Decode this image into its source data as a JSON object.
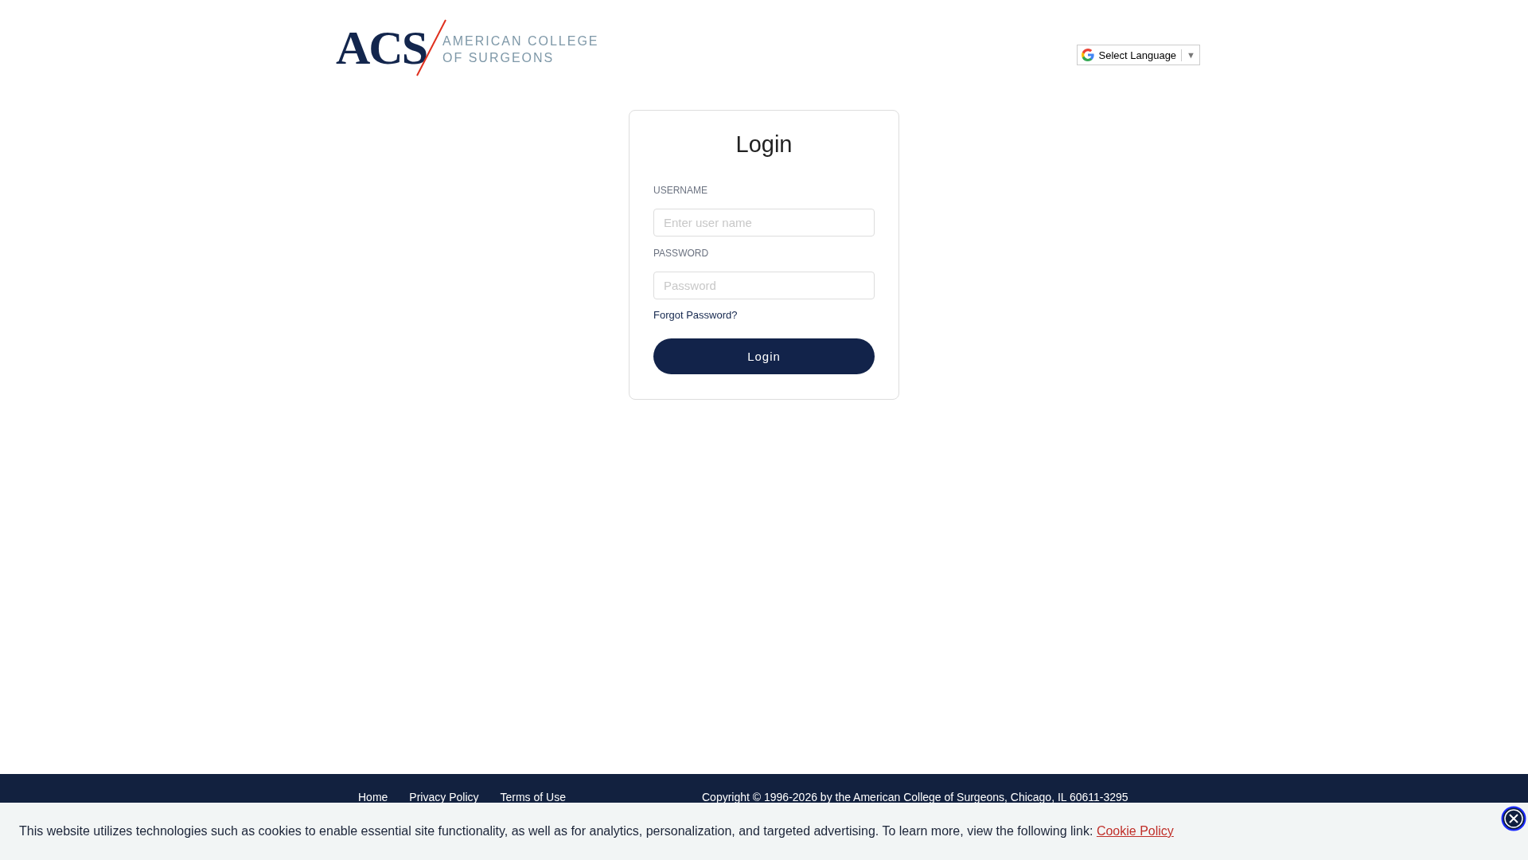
{
  "header": {
    "logo_mark": "ACS",
    "logo_text": [
      "AMERICAN COLLEGE",
      "OF SURGEONS"
    ],
    "language_select": {
      "label": "Select Language",
      "caret": "▼"
    }
  },
  "login": {
    "title": "Login",
    "fields": [
      {
        "label": "USERNAME",
        "placeholder": "Enter user name"
      },
      {
        "label": "PASSWORD",
        "placeholder": "Password"
      }
    ],
    "forgot_link": "Forgot Password?",
    "submit": "Login"
  },
  "footer": {
    "links": [
      "Home",
      "Privacy Policy",
      "Terms of Use"
    ],
    "copyright": "Copyright © 1996-2026 by the American College of Surgeons, Chicago, IL 60611-3295"
  },
  "cookie_banner": {
    "text": "This website utilizes technologies such as cookies to enable essential site functionality, as well as for analytics, personalization, and targeted advertising. To learn more, view the following link:",
    "link": "Cookie Policy"
  }
}
